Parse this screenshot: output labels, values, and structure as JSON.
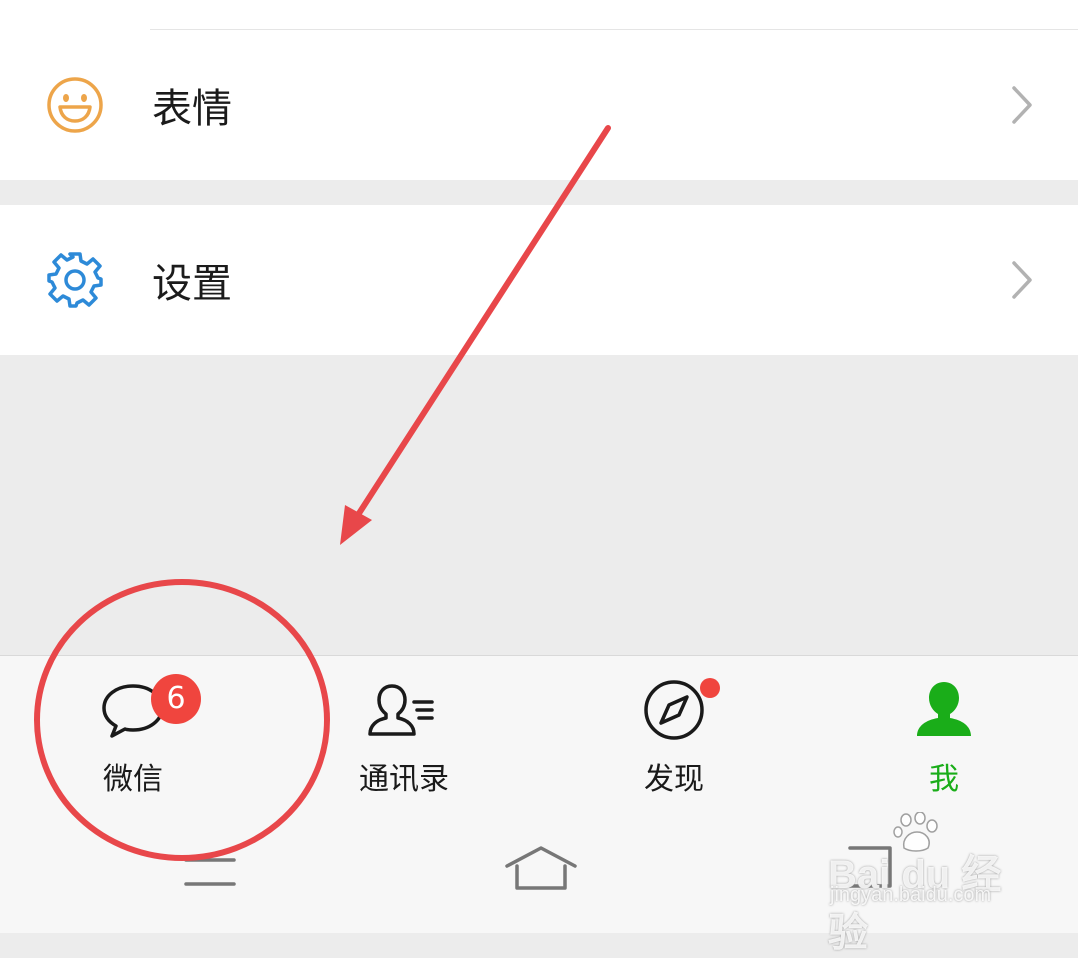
{
  "menu": {
    "items": [
      {
        "label": "表情",
        "icon": "smile-icon"
      },
      {
        "label": "设置",
        "icon": "gear-icon"
      }
    ]
  },
  "tabbar": {
    "tabs": [
      {
        "label": "微信",
        "icon": "chat-bubble-icon",
        "badge": "6"
      },
      {
        "label": "通讯录",
        "icon": "contacts-icon"
      },
      {
        "label": "发现",
        "icon": "compass-icon",
        "dot": true
      },
      {
        "label": "我",
        "icon": "person-icon",
        "active": true
      }
    ]
  },
  "system_nav": {
    "buttons": [
      "menu-icon",
      "home-icon",
      "back-icon"
    ]
  },
  "watermark": {
    "brand": "Bai du 经验",
    "url": "jingyan.baidu.com"
  },
  "colors": {
    "accent_green": "#1aad19",
    "badge_red": "#f0453e",
    "annotation_red": "#e8474a",
    "smile_orange": "#eda54a",
    "gear_blue": "#2d8ad8"
  }
}
